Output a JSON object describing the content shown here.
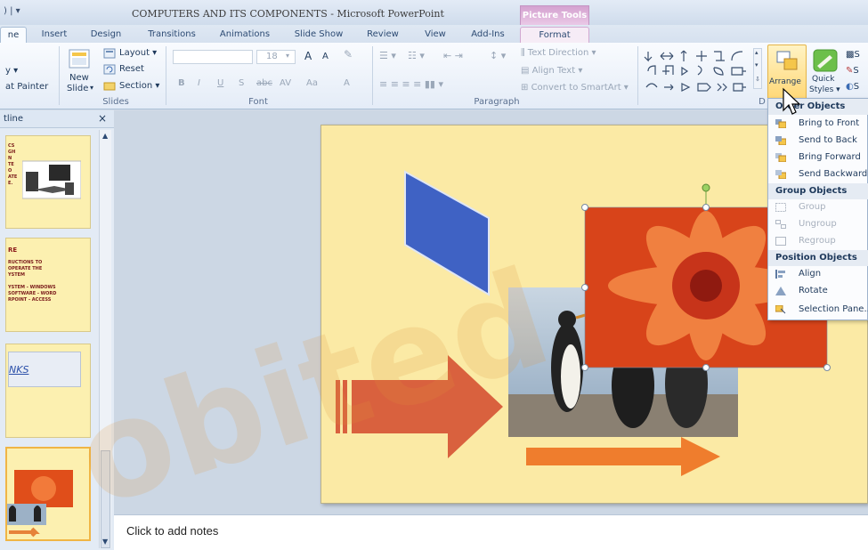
{
  "titlebar": {
    "title": "COMPUTERS AND ITS COMPONENTS  -  Microsoft PowerPoint",
    "context_tab": "Picture Tools"
  },
  "tabs": {
    "home": "ne",
    "insert": "Insert",
    "design": "Design",
    "transitions": "Transitions",
    "animations": "Animations",
    "slide_show": "Slide Show",
    "review": "Review",
    "view": "View",
    "addins": "Add-Ins",
    "format": "Format"
  },
  "ribbon": {
    "clipboard": {
      "format_painter": "at Painter"
    },
    "slides": {
      "new_slide_1": "New",
      "new_slide_2": "Slide",
      "layout": "Layout",
      "reset": "Reset",
      "section": "Section",
      "group": "Slides"
    },
    "font": {
      "size": "18",
      "group": "Font",
      "bold": "B",
      "italic": "I",
      "underline": "U",
      "shadow": "S",
      "strike": "abc",
      "spacing": "AV",
      "case": "Aa",
      "color": "A",
      "grow": "A",
      "shrink": "A"
    },
    "paragraph": {
      "text_direction": "Text Direction",
      "align_text": "Align Text",
      "convert_smartart": "Convert to SmartArt",
      "group": "Paragraph"
    },
    "drawing": {
      "arrange": "Arrange",
      "quick_styles_1": "Quick",
      "quick_styles_2": "Styles",
      "group_letter": "D",
      "s1": "S",
      "s2": "S",
      "s3": "S"
    }
  },
  "left_pane": {
    "tab_label": "tline",
    "slide1_lines": [
      "CS",
      "GH",
      "N",
      "TE",
      "O",
      "ATE",
      "E."
    ],
    "slide2_title": "RE",
    "slide2_lines": [
      "RUCTIONS TO",
      "OPERATE THE",
      "YSTEM",
      "",
      "YSTEM - WINDOWS",
      "SOFTWARE - WORD",
      "RPOINT - ACCESS"
    ],
    "slide3_text": "NKS"
  },
  "arrange_menu": {
    "order_objects": "Order Objects",
    "bring_to_front": "Bring to Front",
    "send_to_back": "Send to Back",
    "bring_forward": "Bring Forward",
    "send_backward": "Send Backward",
    "group_objects": "Group Objects",
    "group": "Group",
    "ungroup": "Ungroup",
    "regroup": "Regroup",
    "position_objects": "Position Objects",
    "align": "Align",
    "rotate": "Rotate",
    "selection_pane": "Selection Pane..."
  },
  "notes": {
    "placeholder": "Click to add notes"
  },
  "watermark": {
    "text": "obited"
  },
  "colors": {
    "slide_bg": "#fbeaa5",
    "blue_shape": "#3f62c4",
    "red_arrow": "#d9613e",
    "orange_arrow": "#ef7d2d",
    "menu_highlight": "#ffd36a"
  }
}
